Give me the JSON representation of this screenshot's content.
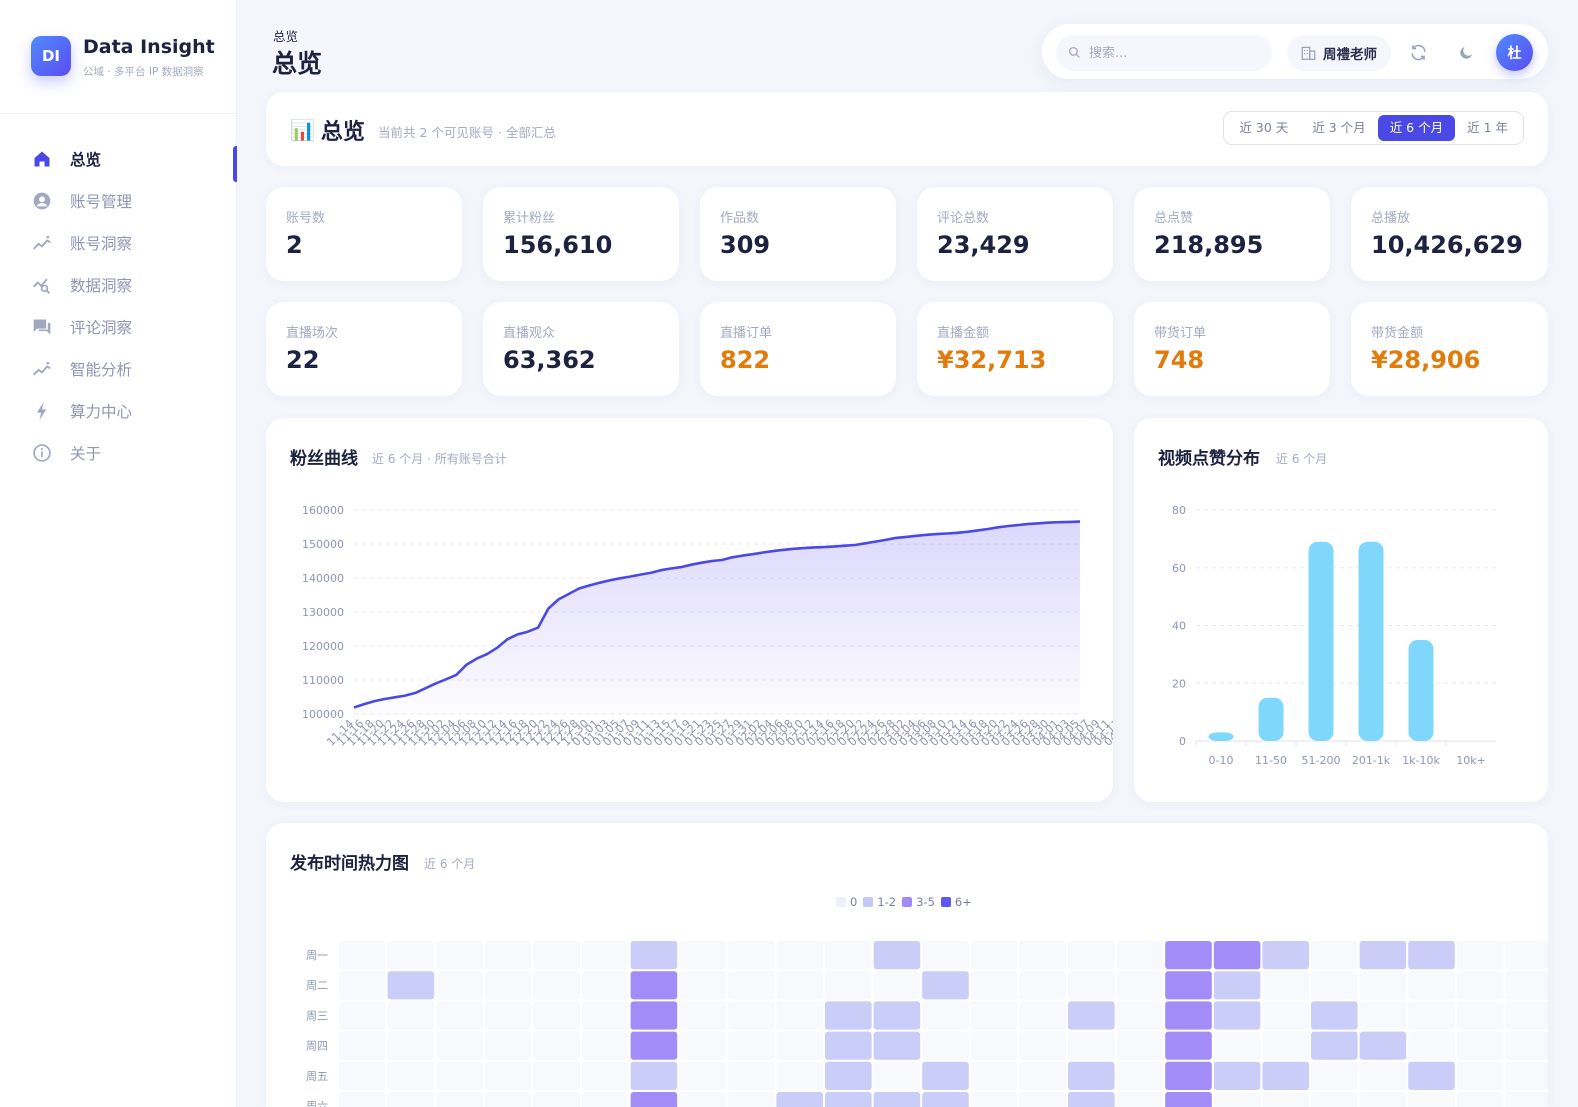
{
  "brand": {
    "logo_text": "DI",
    "name": "Data Insight",
    "tagline": "公域 · 多平台 IP 数据洞察"
  },
  "nav": [
    {
      "label": "总览",
      "icon": "home-icon",
      "active": true
    },
    {
      "label": "账号管理",
      "icon": "account-icon"
    },
    {
      "label": "账号洞察",
      "icon": "trend-icon"
    },
    {
      "label": "数据洞察",
      "icon": "analytics-icon"
    },
    {
      "label": "评论洞察",
      "icon": "comment-icon"
    },
    {
      "label": "智能分析",
      "icon": "ai-trend-icon"
    },
    {
      "label": "算力中心",
      "icon": "bolt-icon"
    },
    {
      "label": "关于",
      "icon": "info-icon"
    }
  ],
  "header": {
    "breadcrumb": "总览",
    "title": "总览"
  },
  "topbar": {
    "search_placeholder": "搜索...",
    "tenant": "周禮老师",
    "avatar": "杜"
  },
  "overview": {
    "emoji": "📊",
    "title": "总览",
    "subtitle": "当前共 2 个可见账号 · 全部汇总",
    "ranges": [
      "近 30 天",
      "近 3 个月",
      "近 6 个月",
      "近 1 年"
    ],
    "active_range": "近 6 个月"
  },
  "colors": {
    "accent": "#4a49e6",
    "orange": "#e07b0c",
    "bar": "#7fd7fb"
  },
  "stats_row1": [
    {
      "label": "账号数",
      "value": "2"
    },
    {
      "label": "累计粉丝",
      "value": "156,610"
    },
    {
      "label": "作品数",
      "value": "309"
    },
    {
      "label": "评论总数",
      "value": "23,429"
    },
    {
      "label": "总点赞",
      "value": "218,895"
    },
    {
      "label": "总播放",
      "value": "10,426,629"
    }
  ],
  "stats_row2": [
    {
      "label": "直播场次",
      "value": "22"
    },
    {
      "label": "直播观众",
      "value": "63,362"
    },
    {
      "label": "直播订单",
      "value": "822",
      "highlight": true
    },
    {
      "label": "直播金额",
      "value": "¥32,713",
      "highlight": true
    },
    {
      "label": "带货订单",
      "value": "748",
      "highlight": true
    },
    {
      "label": "带货金额",
      "value": "¥28,906",
      "highlight": true
    }
  ],
  "fans_chart": {
    "title": "粉丝曲线",
    "subtitle": "近 6 个月 · 所有账号合计"
  },
  "likes_chart": {
    "title": "视频点赞分布",
    "subtitle": "近 6 个月"
  },
  "heatmap": {
    "title": "发布时间热力图",
    "subtitle": "近 6 个月",
    "legend": [
      {
        "label": "0",
        "color": "#eef0f9"
      },
      {
        "label": "1-2",
        "color": "#c3c8f6"
      },
      {
        "label": "3-5",
        "color": "#a18af7"
      },
      {
        "label": "6+",
        "color": "#5a58f0"
      }
    ],
    "days": [
      "周一",
      "周二",
      "周三",
      "周四",
      "周五",
      "周六"
    ],
    "levels": [
      [
        0,
        0,
        0,
        0,
        0,
        0,
        1,
        0,
        0,
        0,
        0,
        1,
        0,
        0,
        0,
        0,
        0,
        2,
        2,
        1,
        0,
        1,
        1,
        0,
        0
      ],
      [
        0,
        1,
        0,
        0,
        0,
        0,
        2,
        0,
        0,
        0,
        0,
        0,
        1,
        0,
        0,
        0,
        0,
        2,
        1,
        0,
        0,
        0,
        0,
        0,
        0
      ],
      [
        0,
        0,
        0,
        0,
        0,
        0,
        2,
        0,
        0,
        0,
        1,
        1,
        0,
        0,
        0,
        1,
        0,
        2,
        1,
        0,
        1,
        0,
        0,
        0,
        0
      ],
      [
        0,
        0,
        0,
        0,
        0,
        0,
        2,
        0,
        0,
        0,
        1,
        1,
        0,
        0,
        0,
        0,
        0,
        2,
        0,
        0,
        1,
        1,
        0,
        0,
        0
      ],
      [
        0,
        0,
        0,
        0,
        0,
        0,
        1,
        0,
        0,
        0,
        1,
        0,
        1,
        0,
        0,
        1,
        0,
        2,
        1,
        1,
        0,
        0,
        1,
        0,
        0
      ],
      [
        0,
        0,
        0,
        0,
        0,
        0,
        2,
        0,
        0,
        1,
        1,
        1,
        1,
        0,
        0,
        1,
        0,
        2,
        0,
        0,
        0,
        0,
        0,
        0,
        0
      ]
    ]
  },
  "chart_data": [
    {
      "type": "area",
      "title": "粉丝曲线",
      "x": [
        "11-14",
        "11-16",
        "11-18",
        "11-20",
        "11-22",
        "11-24",
        "11-26",
        "11-28",
        "11-30",
        "12-02",
        "12-04",
        "12-06",
        "12-08",
        "12-10",
        "12-12",
        "12-14",
        "12-16",
        "12-18",
        "12-20",
        "12-22",
        "12-24",
        "12-26",
        "12-28",
        "12-30",
        "01-01",
        "01-03",
        "01-05",
        "01-07",
        "01-09",
        "01-11",
        "01-13",
        "01-15",
        "01-17",
        "01-19",
        "01-21",
        "01-23",
        "01-25",
        "01-27",
        "01-29",
        "01-31",
        "02-02",
        "02-04",
        "02-06",
        "02-08",
        "02-10",
        "02-12",
        "02-14",
        "02-16",
        "02-18",
        "02-20",
        "02-22",
        "02-24",
        "02-26",
        "02-28",
        "03-02",
        "03-04",
        "03-06",
        "03-08",
        "03-10",
        "03-12",
        "03-14",
        "03-16",
        "03-18",
        "03-20",
        "03-22",
        "03-24",
        "03-26",
        "03-28",
        "03-30",
        "04-01",
        "04-03",
        "04-05",
        "04-07",
        "04-09",
        "04-11",
        "04-13",
        "04-15",
        "04-17",
        "04-19",
        "04-21",
        "04-23",
        "04-25",
        "04-27",
        "04-29",
        "05-01",
        "05-03",
        "05-05",
        "05-07",
        "05-09",
        "05-10"
      ],
      "values": [
        101900,
        102900,
        103800,
        104400,
        104900,
        105400,
        106200,
        107600,
        109000,
        110200,
        111500,
        114500,
        116300,
        117600,
        119500,
        122000,
        123400,
        124200,
        125400,
        131000,
        133700,
        135300,
        136900,
        137800,
        138600,
        139300,
        139900,
        140400,
        141000,
        141500,
        142300,
        142800,
        143200,
        143900,
        144500,
        145000,
        145300,
        146100,
        146600,
        147000,
        147500,
        147900,
        148300,
        148600,
        148800,
        149000,
        149100,
        149300,
        149500,
        149700,
        150200,
        150700,
        151200,
        151800,
        152100,
        152400,
        152700,
        152900,
        153100,
        153300,
        153600,
        154000,
        154400,
        154900,
        155300,
        155600,
        155900,
        156100,
        156300,
        156400,
        156500,
        156600
      ],
      "ylim": [
        100000,
        160000
      ],
      "yticks": [
        100000,
        110000,
        120000,
        130000,
        140000,
        150000,
        160000
      ]
    },
    {
      "type": "bar",
      "title": "视频点赞分布",
      "categories": [
        "0-10",
        "11-50",
        "51-200",
        "201-1k",
        "1k-10k",
        "10k+"
      ],
      "values": [
        3,
        15,
        69,
        69,
        35,
        0
      ],
      "ylim": [
        0,
        80
      ],
      "yticks": [
        0,
        20,
        40,
        60,
        80
      ]
    }
  ]
}
